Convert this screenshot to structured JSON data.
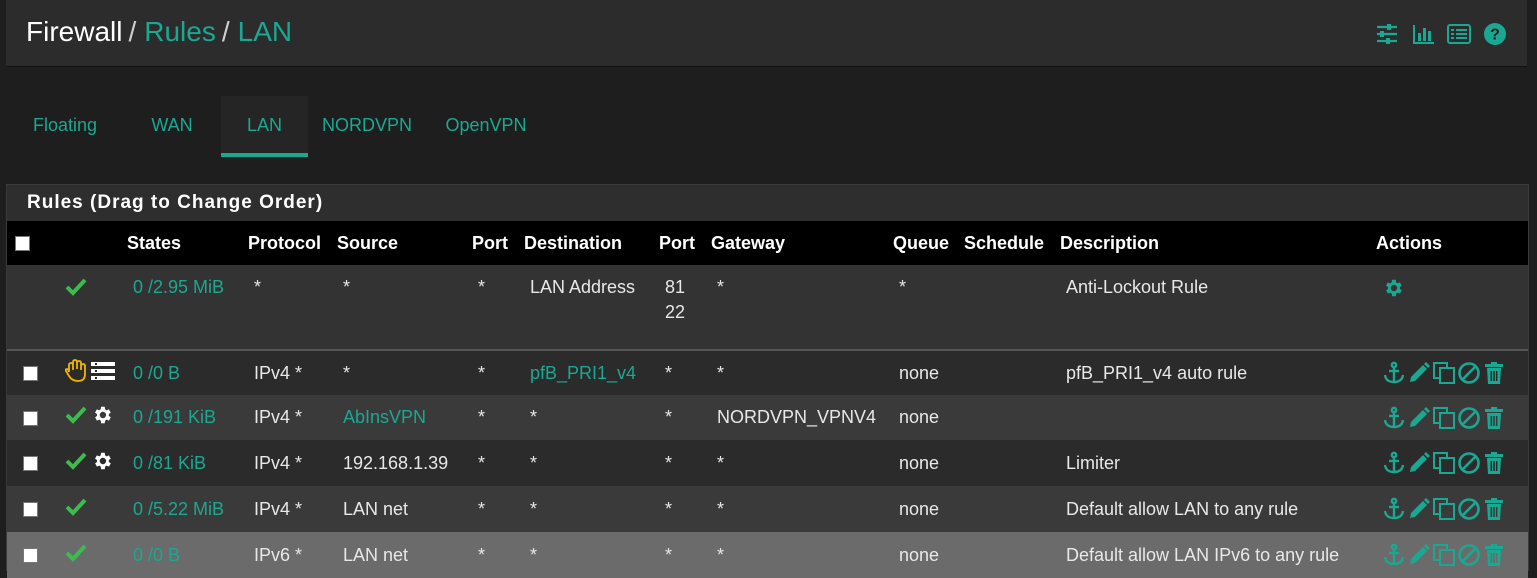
{
  "header": {
    "breadcrumb": [
      "Firewall",
      "Rules",
      "LAN"
    ],
    "separator": "/",
    "icons": [
      "sliders-icon",
      "bar-chart-icon",
      "list-icon",
      "help-icon"
    ]
  },
  "tabs": [
    {
      "label": "Floating",
      "active": false
    },
    {
      "label": "WAN",
      "active": false
    },
    {
      "label": "LAN",
      "active": true
    },
    {
      "label": "NORDVPN",
      "active": false
    },
    {
      "label": "OpenVPN",
      "active": false
    }
  ],
  "panel": {
    "title": "Rules (Drag to Change Order)"
  },
  "table": {
    "columns": [
      "States",
      "Protocol",
      "Source",
      "Port",
      "Destination",
      "Port",
      "Gateway",
      "Queue",
      "Schedule",
      "Description",
      "Actions"
    ],
    "rows": [
      {
        "states": "0 /2.95 MiB",
        "protocol": "*",
        "source": "*",
        "sport": "*",
        "destination": "LAN Address",
        "dport": "81",
        "dport2": "22",
        "gateway": "*",
        "queue": "*",
        "schedule": "",
        "description": "Anti-Lockout Rule",
        "status_icons": [
          "check-icon"
        ]
      },
      {
        "states": "0 /0 B",
        "protocol": "IPv4 *",
        "source": "*",
        "sport": "*",
        "destination": "pfB_PRI1_v4",
        "dport": "*",
        "gateway": "*",
        "queue": "none",
        "schedule": "",
        "description": "pfB_PRI1_v4 auto rule",
        "status_icons": [
          "hand-icon",
          "list-icon"
        ]
      },
      {
        "states": "0 /191 KiB",
        "protocol": "IPv4 *",
        "source": "AbInsVPN",
        "sport": "*",
        "destination": "*",
        "dport": "*",
        "gateway": "NORDVPN_VPNV4",
        "queue": "none",
        "schedule": "",
        "description": "",
        "status_icons": [
          "check-icon",
          "gear-icon"
        ]
      },
      {
        "states": "0 /81 KiB",
        "protocol": "IPv4 *",
        "source": "192.168.1.39",
        "sport": "*",
        "destination": "*",
        "dport": "*",
        "gateway": "*",
        "queue": "none",
        "schedule": "",
        "description": "Limiter",
        "status_icons": [
          "check-icon",
          "gear-icon"
        ]
      },
      {
        "states": "0 /5.22 MiB",
        "protocol": "IPv4 *",
        "source": "LAN net",
        "sport": "*",
        "destination": "*",
        "dport": "*",
        "gateway": "*",
        "queue": "none",
        "schedule": "",
        "description": "Default allow LAN to any rule",
        "status_icons": [
          "check-icon"
        ]
      },
      {
        "states": "0 /0 B",
        "protocol": "IPv6 *",
        "source": "LAN net",
        "sport": "*",
        "destination": "*",
        "dport": "*",
        "gateway": "*",
        "queue": "none",
        "schedule": "",
        "description": "Default allow LAN IPv6 to any rule",
        "status_icons": [
          "check-icon"
        ]
      }
    ],
    "row_actions": [
      "anchor-icon",
      "pencil-icon",
      "copy-icon",
      "disable-icon",
      "trash-icon"
    ]
  },
  "colors": {
    "accent": "#1aa892",
    "check": "#3dbb4f",
    "hand": "#f0b400",
    "background": "#1e1e1e",
    "header": "#2c2c2c"
  }
}
